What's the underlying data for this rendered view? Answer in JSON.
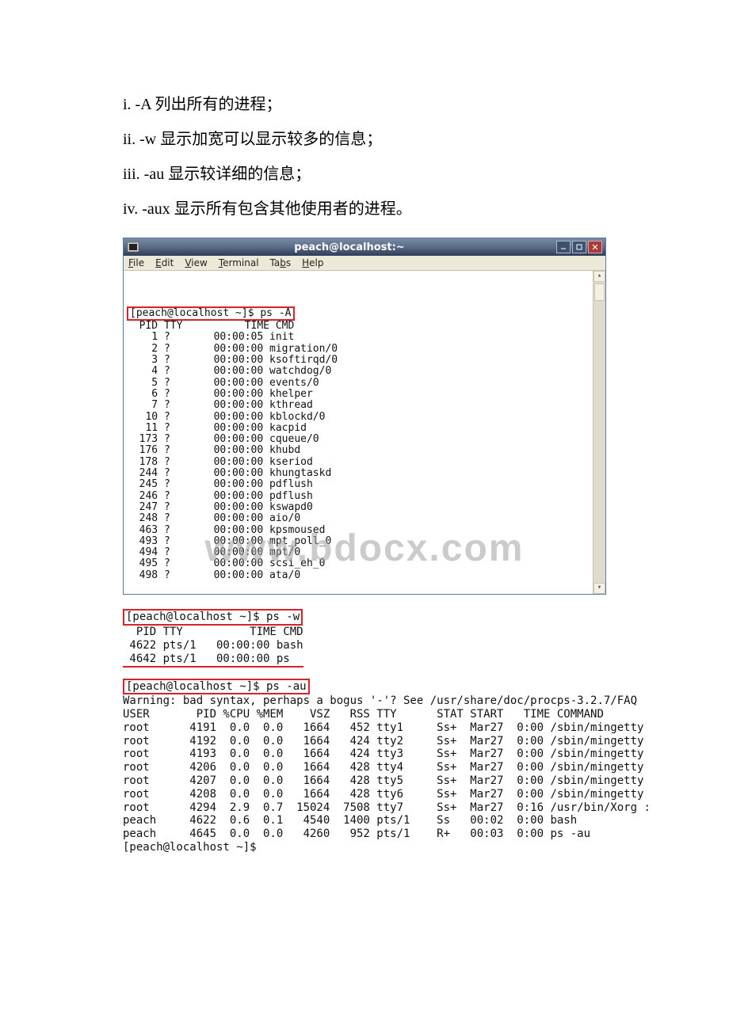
{
  "doc_lines": {
    "i": "i. -A 列出所有的进程；",
    "ii": "ii. -w 显示加宽可以显示较多的信息；",
    "iii": "iii. -au 显示较详细的信息；",
    "iv": "iv. -aux 显示所有包含其他使用者的进程。"
  },
  "terminal": {
    "title": "peach@localhost:~",
    "menu": {
      "file": "File",
      "edit": "Edit",
      "view": "View",
      "terminal": "Terminal",
      "tabs": "Tabs",
      "help": "Help"
    },
    "prompt_cmd": "[peach@localhost ~]$ ps -A",
    "header": "  PID TTY          TIME CMD",
    "rows": [
      {
        "pid": "1",
        "tty": "?",
        "time": "00:00:05",
        "cmd": "init"
      },
      {
        "pid": "2",
        "tty": "?",
        "time": "00:00:00",
        "cmd": "migration/0"
      },
      {
        "pid": "3",
        "tty": "?",
        "time": "00:00:00",
        "cmd": "ksoftirqd/0"
      },
      {
        "pid": "4",
        "tty": "?",
        "time": "00:00:00",
        "cmd": "watchdog/0"
      },
      {
        "pid": "5",
        "tty": "?",
        "time": "00:00:00",
        "cmd": "events/0"
      },
      {
        "pid": "6",
        "tty": "?",
        "time": "00:00:00",
        "cmd": "khelper"
      },
      {
        "pid": "7",
        "tty": "?",
        "time": "00:00:00",
        "cmd": "kthread"
      },
      {
        "pid": "10",
        "tty": "?",
        "time": "00:00:00",
        "cmd": "kblockd/0"
      },
      {
        "pid": "11",
        "tty": "?",
        "time": "00:00:00",
        "cmd": "kacpid"
      },
      {
        "pid": "173",
        "tty": "?",
        "time": "00:00:00",
        "cmd": "cqueue/0"
      },
      {
        "pid": "176",
        "tty": "?",
        "time": "00:00:00",
        "cmd": "khubd"
      },
      {
        "pid": "178",
        "tty": "?",
        "time": "00:00:00",
        "cmd": "kseriod"
      },
      {
        "pid": "244",
        "tty": "?",
        "time": "00:00:00",
        "cmd": "khungtaskd"
      },
      {
        "pid": "245",
        "tty": "?",
        "time": "00:00:00",
        "cmd": "pdflush"
      },
      {
        "pid": "246",
        "tty": "?",
        "time": "00:00:00",
        "cmd": "pdflush"
      },
      {
        "pid": "247",
        "tty": "?",
        "time": "00:00:00",
        "cmd": "kswapd0"
      },
      {
        "pid": "248",
        "tty": "?",
        "time": "00:00:00",
        "cmd": "aio/0"
      },
      {
        "pid": "463",
        "tty": "?",
        "time": "00:00:00",
        "cmd": "kpsmoused"
      },
      {
        "pid": "493",
        "tty": "?",
        "time": "00:00:00",
        "cmd": "mpt_poll_0"
      },
      {
        "pid": "494",
        "tty": "?",
        "time": "00:00:00",
        "cmd": "mpt/0"
      },
      {
        "pid": "495",
        "tty": "?",
        "time": "00:00:00",
        "cmd": "scsi_eh_0"
      },
      {
        "pid": "498",
        "tty": "?",
        "time": "00:00:00",
        "cmd": "ata/0"
      }
    ]
  },
  "watermark": "www.bdocx.com",
  "psw": {
    "prompt": "[peach@localhost ~]$ ps -w",
    "header": "  PID TTY          TIME CMD",
    "rows": [
      {
        "pid": "4622",
        "tty": "pts/1",
        "time": "00:00:00",
        "cmd": "bash"
      },
      {
        "pid": "4642",
        "tty": "pts/1",
        "time": "00:00:00",
        "cmd": "ps"
      }
    ]
  },
  "psau": {
    "prompt": "[peach@localhost ~]$ ps -au",
    "warning": "Warning: bad syntax, perhaps a bogus '-'? See /usr/share/doc/procps-3.2.7/FAQ",
    "header": "USER       PID %CPU %MEM    VSZ   RSS TTY      STAT START   TIME COMMAND",
    "rows": [
      {
        "user": "root",
        "pid": "4191",
        "cpu": "0.0",
        "mem": "0.0",
        "vsz": "1664",
        "rss": "452",
        "tty": "tty1",
        "stat": "Ss+",
        "start": "Mar27",
        "time": "0:00",
        "cmd": "/sbin/mingetty"
      },
      {
        "user": "root",
        "pid": "4192",
        "cpu": "0.0",
        "mem": "0.0",
        "vsz": "1664",
        "rss": "424",
        "tty": "tty2",
        "stat": "Ss+",
        "start": "Mar27",
        "time": "0:00",
        "cmd": "/sbin/mingetty"
      },
      {
        "user": "root",
        "pid": "4193",
        "cpu": "0.0",
        "mem": "0.0",
        "vsz": "1664",
        "rss": "424",
        "tty": "tty3",
        "stat": "Ss+",
        "start": "Mar27",
        "time": "0:00",
        "cmd": "/sbin/mingetty"
      },
      {
        "user": "root",
        "pid": "4206",
        "cpu": "0.0",
        "mem": "0.0",
        "vsz": "1664",
        "rss": "428",
        "tty": "tty4",
        "stat": "Ss+",
        "start": "Mar27",
        "time": "0:00",
        "cmd": "/sbin/mingetty"
      },
      {
        "user": "root",
        "pid": "4207",
        "cpu": "0.0",
        "mem": "0.0",
        "vsz": "1664",
        "rss": "428",
        "tty": "tty5",
        "stat": "Ss+",
        "start": "Mar27",
        "time": "0:00",
        "cmd": "/sbin/mingetty"
      },
      {
        "user": "root",
        "pid": "4208",
        "cpu": "0.0",
        "mem": "0.0",
        "vsz": "1664",
        "rss": "428",
        "tty": "tty6",
        "stat": "Ss+",
        "start": "Mar27",
        "time": "0:00",
        "cmd": "/sbin/mingetty"
      },
      {
        "user": "root",
        "pid": "4294",
        "cpu": "2.9",
        "mem": "0.7",
        "vsz": "15024",
        "rss": "7508",
        "tty": "tty7",
        "stat": "Ss+",
        "start": "Mar27",
        "time": "0:16",
        "cmd": "/usr/bin/Xorg :"
      },
      {
        "user": "peach",
        "pid": "4622",
        "cpu": "0.6",
        "mem": "0.1",
        "vsz": "4540",
        "rss": "1400",
        "tty": "pts/1",
        "stat": "Ss",
        "start": "00:02",
        "time": "0:00",
        "cmd": "bash"
      },
      {
        "user": "peach",
        "pid": "4645",
        "cpu": "0.0",
        "mem": "0.0",
        "vsz": "4260",
        "rss": "952",
        "tty": "pts/1",
        "stat": "R+",
        "start": "00:03",
        "time": "0:00",
        "cmd": "ps -au"
      }
    ],
    "final_prompt": "[peach@localhost ~]$"
  }
}
